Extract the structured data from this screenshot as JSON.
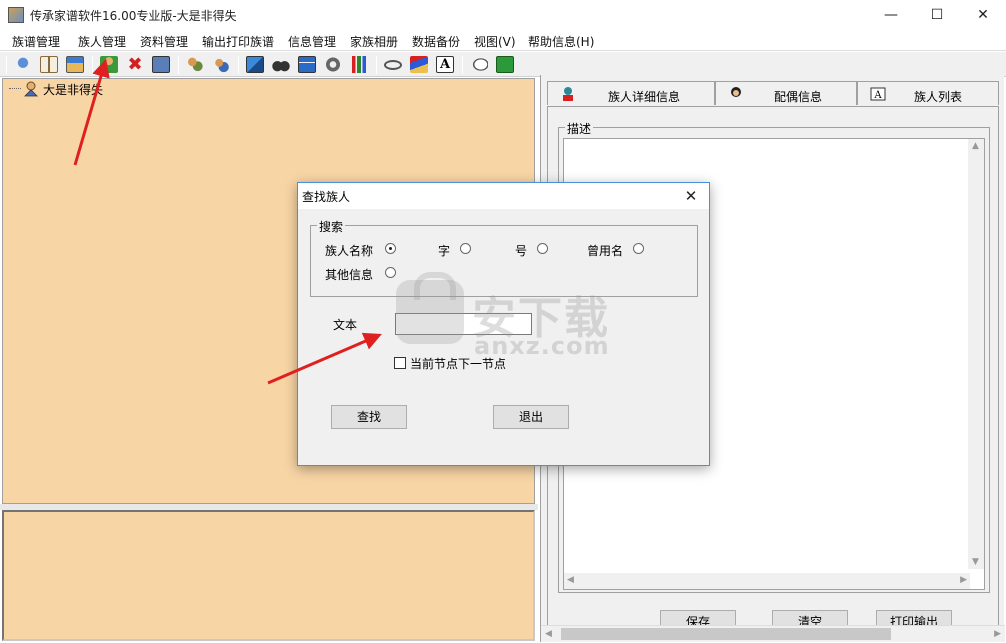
{
  "window": {
    "title": "传承家谱软件16.00专业版-大是非得失",
    "minimize_glyph": "—",
    "maximize_glyph": "☐",
    "close_glyph": "✕"
  },
  "menu": {
    "items": [
      "族谱管理",
      "族人管理",
      "资料管理",
      "输出打印族谱",
      "信息管理",
      "家族相册",
      "数据备份",
      "视图(V)",
      "帮助信息(H)"
    ]
  },
  "toolbar": {
    "icons": [
      "pin-icon",
      "book-icon",
      "image-icon",
      "add-person-icon",
      "delete-icon",
      "portrait-icon",
      "group-icon",
      "family-icon",
      "layout-icon",
      "binoculars-icon",
      "tree-icon",
      "gear-icon",
      "bar-chart-icon",
      "link-icon",
      "books-icon",
      "font-icon",
      "chat-icon",
      "exit-icon"
    ]
  },
  "tree": {
    "root_label": "大是非得失"
  },
  "right_panel": {
    "tabs": [
      "族人详细信息",
      "配偶信息",
      "族人列表"
    ],
    "description_title": "描述",
    "buttons": {
      "save": "保存",
      "clear": "清空",
      "print": "打印输出"
    }
  },
  "dialog": {
    "title": "查找族人",
    "search_group_title": "搜索",
    "options": [
      {
        "label": "族人名称",
        "selected": true
      },
      {
        "label": "字",
        "selected": false
      },
      {
        "label": "号",
        "selected": false
      },
      {
        "label": "曾用名",
        "selected": false
      },
      {
        "label": "其他信息",
        "selected": false
      }
    ],
    "text_label": "文本",
    "text_value": "",
    "checkbox_label": "当前节点下一节点",
    "checkbox_checked": false,
    "find_button": "查找",
    "exit_button": "退出",
    "close_glyph": "✕"
  },
  "watermark": {
    "main": "安下载",
    "sub": "anxz.com"
  },
  "colors": {
    "tree_background": "#f8d5a5",
    "annotation_arrow": "#e02020",
    "dialog_border": "#4a90d9"
  }
}
